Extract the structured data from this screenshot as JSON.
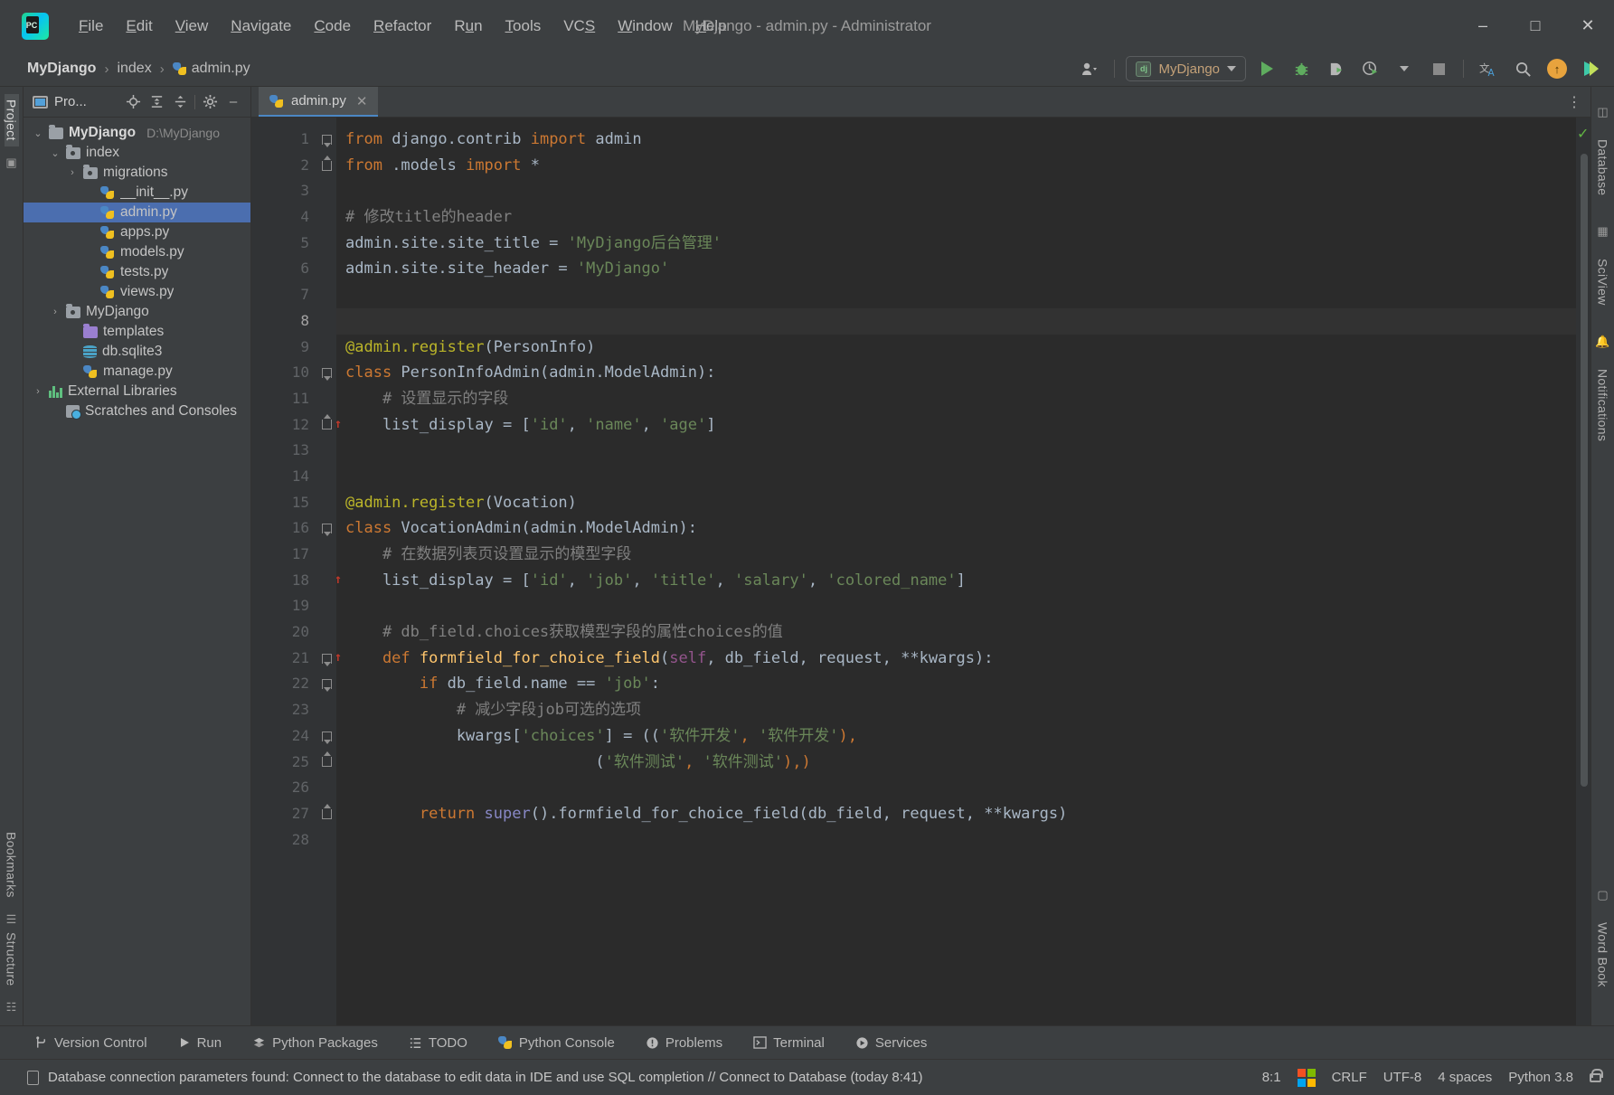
{
  "window": {
    "title": "MyDjango - admin.py - Administrator",
    "logo_text": "PC",
    "minimize": "–",
    "maximize": "□",
    "close": "✕"
  },
  "menu": [
    {
      "label": "File",
      "accel": "F"
    },
    {
      "label": "Edit",
      "accel": "E"
    },
    {
      "label": "View",
      "accel": "V"
    },
    {
      "label": "Navigate",
      "accel": "N"
    },
    {
      "label": "Code",
      "accel": "C"
    },
    {
      "label": "Refactor",
      "accel": "R"
    },
    {
      "label": "Run",
      "accel": "u"
    },
    {
      "label": "Tools",
      "accel": "T"
    },
    {
      "label": "VCS",
      "accel": "S"
    },
    {
      "label": "Window",
      "accel": "W"
    },
    {
      "label": "Help",
      "accel": "H"
    }
  ],
  "breadcrumb": {
    "project": "MyDjango",
    "folder": "index",
    "file": "admin.py",
    "separator": "›"
  },
  "toolbar": {
    "run_config": "MyDjango",
    "run_config_badge": "dj",
    "profile_icon": "user-profile-icon",
    "run_icon": "run-icon",
    "debug_icon": "debug-icon",
    "run_with_profiler_icon": "run-with-profiler-icon",
    "coverage_icon": "run-with-coverage-icon",
    "stop_icon": "stop-icon",
    "translate_icon": "translate-icon",
    "search_icon": "search-everywhere-icon",
    "update_icon": "update-project-icon",
    "ide_feature_icon": "ide-feature-icon"
  },
  "project_panel": {
    "title": "Pro...",
    "actions": [
      "locate-icon",
      "expand-all-icon",
      "collapse-all-icon",
      "settings-gear-icon",
      "hide-icon"
    ],
    "tree": [
      {
        "label": "MyDjango",
        "path": "D:\\MyDjango",
        "icon": "folder",
        "indent": 0,
        "arrow": "v",
        "bold": true,
        "selected": false
      },
      {
        "label": "index",
        "path": "",
        "icon": "folder-source",
        "indent": 1,
        "arrow": "v",
        "bold": false,
        "selected": false
      },
      {
        "label": "migrations",
        "path": "",
        "icon": "folder-source",
        "indent": 2,
        "arrow": ">",
        "bold": false,
        "selected": false
      },
      {
        "label": "__init__.py",
        "path": "",
        "icon": "python-file",
        "indent": 3,
        "arrow": "",
        "bold": false,
        "selected": false
      },
      {
        "label": "admin.py",
        "path": "",
        "icon": "python-file",
        "indent": 3,
        "arrow": "",
        "bold": false,
        "selected": true
      },
      {
        "label": "apps.py",
        "path": "",
        "icon": "python-file",
        "indent": 3,
        "arrow": "",
        "bold": false,
        "selected": false
      },
      {
        "label": "models.py",
        "path": "",
        "icon": "python-file",
        "indent": 3,
        "arrow": "",
        "bold": false,
        "selected": false
      },
      {
        "label": "tests.py",
        "path": "",
        "icon": "python-file",
        "indent": 3,
        "arrow": "",
        "bold": false,
        "selected": false
      },
      {
        "label": "views.py",
        "path": "",
        "icon": "python-file",
        "indent": 3,
        "arrow": "",
        "bold": false,
        "selected": false
      },
      {
        "label": "MyDjango",
        "path": "",
        "icon": "folder-source",
        "indent": 1,
        "arrow": ">",
        "bold": false,
        "selected": false
      },
      {
        "label": "templates",
        "path": "",
        "icon": "folder-purple",
        "indent": 2,
        "arrow": "",
        "bold": false,
        "selected": false
      },
      {
        "label": "db.sqlite3",
        "path": "",
        "icon": "database-file",
        "indent": 2,
        "arrow": "",
        "bold": false,
        "selected": false
      },
      {
        "label": "manage.py",
        "path": "",
        "icon": "python-file",
        "indent": 2,
        "arrow": "",
        "bold": false,
        "selected": false
      },
      {
        "label": "External Libraries",
        "path": "",
        "icon": "libraries",
        "indent": 0,
        "arrow": ">",
        "bold": false,
        "selected": false
      },
      {
        "label": "Scratches and Consoles",
        "path": "",
        "icon": "scratches",
        "indent": 1,
        "arrow": "",
        "bold": false,
        "selected": false
      }
    ]
  },
  "left_strip": {
    "project_label": "Project",
    "bookmarks_label": "Bookmarks",
    "structure_label": "Structure"
  },
  "right_strip": {
    "database_label": "Database",
    "sciview_label": "SciView",
    "notifications_label": "Notifications",
    "wordbook_label": "Word Book"
  },
  "editor": {
    "tab": "admin.py",
    "tab_close": "✕",
    "options_icon": "editor-options-icon",
    "inspection_status": "✓",
    "lines": [
      {
        "n": 1,
        "fold": "open",
        "marker": "",
        "current": false,
        "tokens": [
          {
            "t": "from ",
            "c": "kw"
          },
          {
            "t": "django.contrib ",
            "c": "ident"
          },
          {
            "t": "import ",
            "c": "kw"
          },
          {
            "t": "admin",
            "c": "ident"
          }
        ]
      },
      {
        "n": 2,
        "fold": "end",
        "marker": "",
        "current": false,
        "tokens": [
          {
            "t": "from ",
            "c": "kw"
          },
          {
            "t": ".models ",
            "c": "ident"
          },
          {
            "t": "import ",
            "c": "kw"
          },
          {
            "t": "*",
            "c": "ident"
          }
        ]
      },
      {
        "n": 3,
        "fold": "",
        "marker": "",
        "current": false,
        "tokens": []
      },
      {
        "n": 4,
        "fold": "",
        "marker": "",
        "current": false,
        "tokens": [
          {
            "t": "# 修改title的header",
            "c": "cmt"
          }
        ]
      },
      {
        "n": 5,
        "fold": "",
        "marker": "",
        "current": false,
        "tokens": [
          {
            "t": "admin.site.site_title ",
            "c": "ident"
          },
          {
            "t": "= ",
            "c": "ident"
          },
          {
            "t": "'MyDjango后台管理'",
            "c": "str"
          }
        ]
      },
      {
        "n": 6,
        "fold": "",
        "marker": "",
        "current": false,
        "tokens": [
          {
            "t": "admin.site.site_header ",
            "c": "ident"
          },
          {
            "t": "= ",
            "c": "ident"
          },
          {
            "t": "'MyDjango'",
            "c": "str"
          }
        ]
      },
      {
        "n": 7,
        "fold": "",
        "marker": "",
        "current": false,
        "tokens": []
      },
      {
        "n": 8,
        "fold": "",
        "marker": "",
        "current": true,
        "tokens": []
      },
      {
        "n": 9,
        "fold": "",
        "marker": "",
        "current": false,
        "tokens": [
          {
            "t": "@admin.register",
            "c": "dec"
          },
          {
            "t": "(PersonInfo)",
            "c": "ident"
          }
        ]
      },
      {
        "n": 10,
        "fold": "open",
        "marker": "",
        "current": false,
        "tokens": [
          {
            "t": "class ",
            "c": "kw"
          },
          {
            "t": "PersonInfoAdmin",
            "c": "ident"
          },
          {
            "t": "(admin.ModelAdmin):",
            "c": "ident"
          }
        ]
      },
      {
        "n": 11,
        "fold": "",
        "marker": "",
        "current": false,
        "tokens": [
          {
            "t": "    # 设置显示的字段",
            "c": "cmt"
          }
        ]
      },
      {
        "n": 12,
        "fold": "end",
        "marker": "ovr",
        "current": false,
        "tokens": [
          {
            "t": "    list_display ",
            "c": "ident"
          },
          {
            "t": "= [",
            "c": "ident"
          },
          {
            "t": "'id'",
            "c": "str"
          },
          {
            "t": ", ",
            "c": "ident"
          },
          {
            "t": "'name'",
            "c": "str"
          },
          {
            "t": ", ",
            "c": "ident"
          },
          {
            "t": "'age'",
            "c": "str"
          },
          {
            "t": "]",
            "c": "ident"
          }
        ]
      },
      {
        "n": 13,
        "fold": "",
        "marker": "",
        "current": false,
        "tokens": []
      },
      {
        "n": 14,
        "fold": "",
        "marker": "",
        "current": false,
        "tokens": []
      },
      {
        "n": 15,
        "fold": "",
        "marker": "",
        "current": false,
        "tokens": [
          {
            "t": "@admin.register",
            "c": "dec"
          },
          {
            "t": "(Vocation)",
            "c": "ident"
          }
        ]
      },
      {
        "n": 16,
        "fold": "open",
        "marker": "",
        "current": false,
        "tokens": [
          {
            "t": "class ",
            "c": "kw"
          },
          {
            "t": "VocationAdmin",
            "c": "ident"
          },
          {
            "t": "(admin.ModelAdmin):",
            "c": "ident"
          }
        ]
      },
      {
        "n": 17,
        "fold": "",
        "marker": "",
        "current": false,
        "tokens": [
          {
            "t": "    # 在数据列表页设置显示的模型字段",
            "c": "cmt"
          }
        ]
      },
      {
        "n": 18,
        "fold": "",
        "marker": "ovr",
        "current": false,
        "tokens": [
          {
            "t": "    list_display ",
            "c": "ident"
          },
          {
            "t": "= [",
            "c": "ident"
          },
          {
            "t": "'id'",
            "c": "str"
          },
          {
            "t": ", ",
            "c": "ident"
          },
          {
            "t": "'job'",
            "c": "str"
          },
          {
            "t": ", ",
            "c": "ident"
          },
          {
            "t": "'title'",
            "c": "str"
          },
          {
            "t": ", ",
            "c": "ident"
          },
          {
            "t": "'salary'",
            "c": "str"
          },
          {
            "t": ", ",
            "c": "ident"
          },
          {
            "t": "'colored_name'",
            "c": "str"
          },
          {
            "t": "]",
            "c": "ident"
          }
        ]
      },
      {
        "n": 19,
        "fold": "",
        "marker": "",
        "current": false,
        "tokens": []
      },
      {
        "n": 20,
        "fold": "",
        "marker": "",
        "current": false,
        "tokens": [
          {
            "t": "    # db_field.choices获取模型字段的属性choices的值",
            "c": "cmt"
          }
        ]
      },
      {
        "n": 21,
        "fold": "open",
        "marker": "ovr",
        "current": false,
        "tokens": [
          {
            "t": "    def ",
            "c": "kw"
          },
          {
            "t": "formfield_for_choice_field",
            "c": "fn"
          },
          {
            "t": "(",
            "c": "ident"
          },
          {
            "t": "self",
            "c": "self"
          },
          {
            "t": ", db_field, request, **kwargs):",
            "c": "ident"
          }
        ]
      },
      {
        "n": 22,
        "fold": "open",
        "marker": "",
        "current": false,
        "tokens": [
          {
            "t": "        if ",
            "c": "kw"
          },
          {
            "t": "db_field.name == ",
            "c": "ident"
          },
          {
            "t": "'job'",
            "c": "str"
          },
          {
            "t": ":",
            "c": "ident"
          }
        ]
      },
      {
        "n": 23,
        "fold": "",
        "marker": "",
        "current": false,
        "tokens": [
          {
            "t": "            # 减少字段job可选的选项",
            "c": "cmt"
          }
        ]
      },
      {
        "n": 24,
        "fold": "open",
        "marker": "",
        "current": false,
        "tokens": [
          {
            "t": "            kwargs[",
            "c": "ident"
          },
          {
            "t": "'choices'",
            "c": "str"
          },
          {
            "t": "] = ((",
            "c": "ident"
          },
          {
            "t": "'软件开发'",
            "c": "str"
          },
          {
            "t": ", ",
            "c": "kw"
          },
          {
            "t": "'软件开发'",
            "c": "str"
          },
          {
            "t": "),",
            "c": "kw"
          }
        ]
      },
      {
        "n": 25,
        "fold": "end",
        "marker": "",
        "current": false,
        "tokens": [
          {
            "t": "                           (",
            "c": "ident"
          },
          {
            "t": "'软件测试'",
            "c": "str"
          },
          {
            "t": ", ",
            "c": "kw"
          },
          {
            "t": "'软件测试'",
            "c": "str"
          },
          {
            "t": "),)",
            "c": "kw"
          }
        ]
      },
      {
        "n": 26,
        "fold": "",
        "marker": "",
        "current": false,
        "tokens": []
      },
      {
        "n": 27,
        "fold": "end",
        "marker": "",
        "current": false,
        "tokens": [
          {
            "t": "        return ",
            "c": "kw"
          },
          {
            "t": "super",
            "c": "supr"
          },
          {
            "t": "().formfield_for_choice_field(db_field, request, **kwargs)",
            "c": "ident"
          }
        ]
      },
      {
        "n": 28,
        "fold": "",
        "marker": "",
        "current": false,
        "tokens": []
      }
    ]
  },
  "tool_windows": [
    {
      "label": "Version Control",
      "icon": "branch-icon"
    },
    {
      "label": "Run",
      "icon": "run-icon"
    },
    {
      "label": "Python Packages",
      "icon": "packages-icon"
    },
    {
      "label": "TODO",
      "icon": "todo-list-icon"
    },
    {
      "label": "Python Console",
      "icon": "python-console-icon"
    },
    {
      "label": "Problems",
      "icon": "problems-icon"
    },
    {
      "label": "Terminal",
      "icon": "terminal-icon"
    },
    {
      "label": "Services",
      "icon": "services-icon"
    }
  ],
  "status_bar": {
    "message": "Database connection parameters found: Connect to the database to edit data in IDE and use SQL completion // Connect to Database (today 8:41)",
    "message_icon": "database-notification-icon",
    "caret_position": "8:1",
    "os_indicator": "windows-logo-icon",
    "line_separator": "CRLF",
    "encoding": "UTF-8",
    "indent": "4 spaces",
    "interpreter": "Python 3.8",
    "lock": "unlocked-icon"
  }
}
